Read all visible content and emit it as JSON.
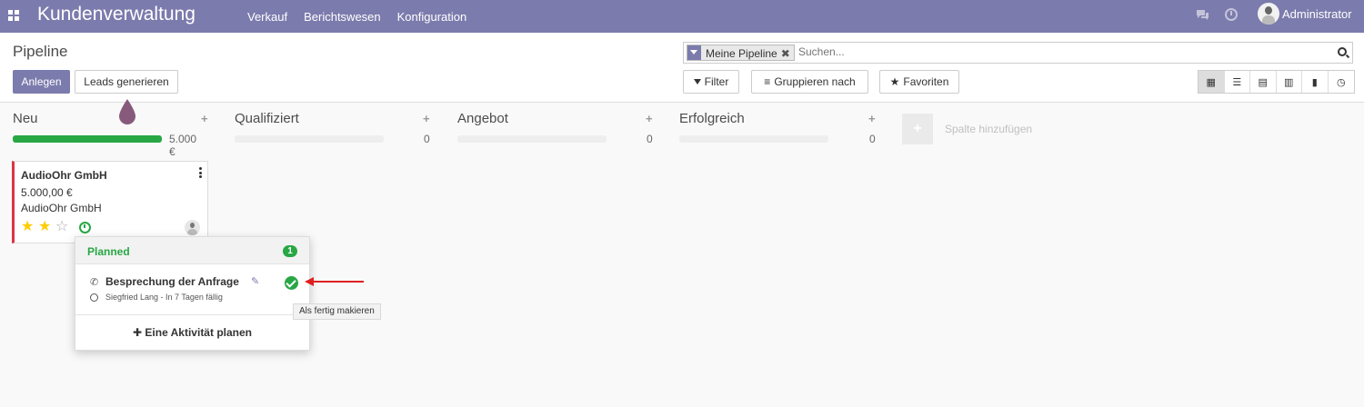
{
  "navbar": {
    "brand": "Kundenverwaltung",
    "menu": [
      "Verkauf",
      "Berichtswesen",
      "Konfiguration"
    ],
    "user_name": "Administrator"
  },
  "control_panel": {
    "breadcrumb": "Pipeline",
    "create_label": "Anlegen",
    "generate_label": "Leads generieren",
    "search": {
      "facet": "Meine Pipeline",
      "facet_remove": "✖",
      "placeholder": "Suchen..."
    },
    "filter_label": "Filter",
    "groupby_label": "Gruppieren nach",
    "favorites_label": "Favoriten"
  },
  "columns": [
    {
      "title": "Neu",
      "add": "+",
      "sum": "5.000 €",
      "progress": 1.0
    },
    {
      "title": "Qualifiziert",
      "add": "+",
      "sum": "0",
      "progress": 0
    },
    {
      "title": "Angebot",
      "add": "+",
      "sum": "0",
      "progress": 0
    },
    {
      "title": "Erfolgreich",
      "add": "+",
      "sum": "0",
      "progress": 0
    }
  ],
  "card": {
    "title": "AudioOhr GmbH",
    "amount": "5.000,00 €",
    "company": "AudioOhr GmbH",
    "rating": 2,
    "rating_max": 3
  },
  "popover": {
    "header": "Planned",
    "count": "1",
    "activity_title": "Besprechung der Anfrage",
    "activity_meta": "Siegfried Lang - In 7 Tagen fällig",
    "plan_label": "✚ Eine Aktivität planen"
  },
  "tooltip": "Als fertig makieren",
  "add_column": {
    "icon": "+",
    "label": "Spalte hinzufügen"
  },
  "colors": {
    "brand": "#7c7bad",
    "success": "#28a745",
    "danger": "#dc3545",
    "arrow": "#e02020"
  }
}
